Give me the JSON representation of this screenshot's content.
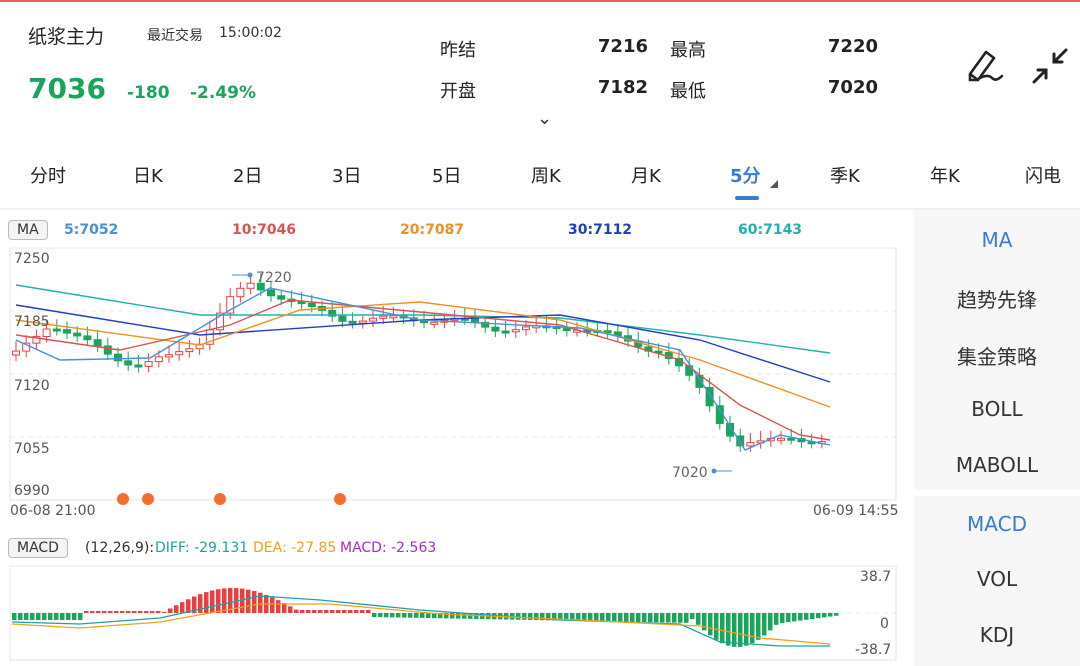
{
  "header": {
    "title": "纸浆主力",
    "last_trade_label": "最近交易",
    "last_trade_time": "15:00:02",
    "price": "7036",
    "change": "-180",
    "change_pct": "-2.49%",
    "stats": [
      {
        "label": "昨结",
        "value": "7216"
      },
      {
        "label": "最高",
        "value": "7220"
      },
      {
        "label": "开盘",
        "value": "7182"
      },
      {
        "label": "最低",
        "value": "7020"
      }
    ],
    "expand_chevron": "⌄"
  },
  "tabs": [
    {
      "label": "分时",
      "active": false
    },
    {
      "label": "日K",
      "active": false
    },
    {
      "label": "2日",
      "active": false
    },
    {
      "label": "3日",
      "active": false
    },
    {
      "label": "5日",
      "active": false
    },
    {
      "label": "周K",
      "active": false
    },
    {
      "label": "月K",
      "active": false
    },
    {
      "label": "5分",
      "active": true
    },
    {
      "label": "季K",
      "active": false
    },
    {
      "label": "年K",
      "active": false
    },
    {
      "label": "闪电",
      "active": false
    }
  ],
  "ma_bar": {
    "badge": "MA",
    "items": [
      {
        "text": "5:7052",
        "color": "#4a90d9"
      },
      {
        "text": "10:7046",
        "color": "#d9534f"
      },
      {
        "text": "20:7087",
        "color": "#f0901f"
      },
      {
        "text": "30:7112",
        "color": "#1f3fbf"
      },
      {
        "text": "60:7143",
        "color": "#20b2aa"
      }
    ]
  },
  "price_axis": [
    "7250",
    "7185",
    "7120",
    "7055",
    "6990"
  ],
  "time_axis": {
    "start": "06-08 21:00",
    "end": "06-09 14:55"
  },
  "annotations": {
    "high": "7220",
    "low": "7020"
  },
  "macd_bar": {
    "badge": "MACD",
    "params": "(12,26,9):",
    "diff": "DIFF: -29.131",
    "dea": "DEA: -27.85",
    "macd": "MACD: -2.563"
  },
  "macd_axis": {
    "top": "38.7",
    "mid": "0",
    "bottom": "-38.7"
  },
  "sidebar": {
    "top": [
      "MA",
      "趋势先锋",
      "集金策略",
      "BOLL",
      "MABOLL"
    ],
    "bottom": [
      "MACD",
      "VOL",
      "KDJ"
    ]
  },
  "colors": {
    "up": "#e84040",
    "down": "#19a55b",
    "accent": "#3a7bd5"
  },
  "icons": {
    "draw": "pen-icon",
    "fullscreen": "collapse-icon"
  }
}
